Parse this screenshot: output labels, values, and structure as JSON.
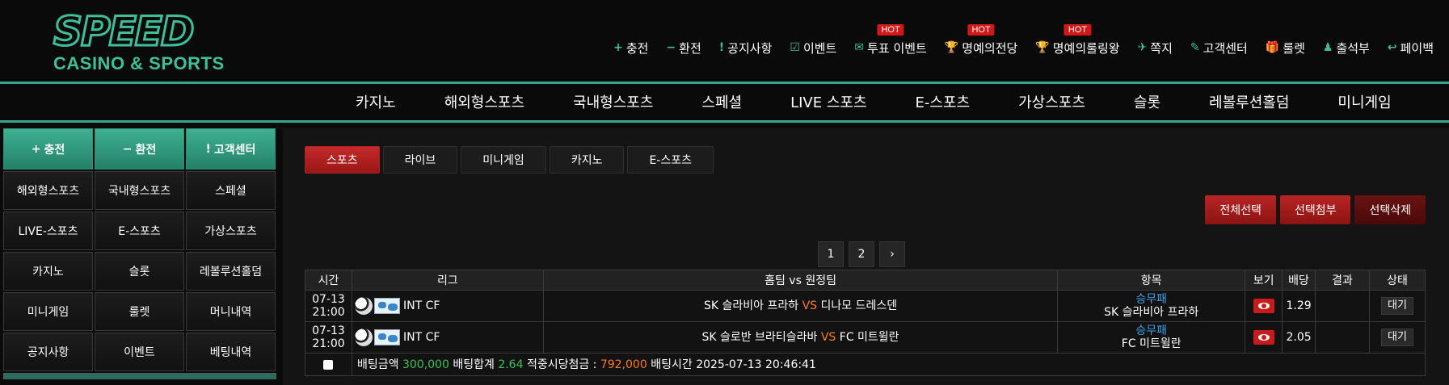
{
  "logo": {
    "word": "SPEED",
    "sub": "CASINO & SPORTS"
  },
  "topnav": [
    {
      "icon": "+",
      "label": "충전",
      "hot": ""
    },
    {
      "icon": "−",
      "label": "환전",
      "hot": ""
    },
    {
      "icon": "!",
      "label": "공지사항",
      "hot": ""
    },
    {
      "icon": "☑",
      "label": "이벤트",
      "hot": ""
    },
    {
      "icon": "✉",
      "label": "투표 이벤트",
      "hot": "HOT"
    },
    {
      "icon": "🏆",
      "label": "명예의전당",
      "hot": "HOT"
    },
    {
      "icon": "🏆",
      "label": "명예의룰링왕",
      "hot": "HOT"
    },
    {
      "icon": "✈",
      "label": "쪽지",
      "hot": ""
    },
    {
      "icon": "✎",
      "label": "고객센터",
      "hot": ""
    },
    {
      "icon": "🎁",
      "label": "룰렛",
      "hot": ""
    },
    {
      "icon": "♟",
      "label": "출석부",
      "hot": ""
    },
    {
      "icon": "↩",
      "label": "페이백",
      "hot": ""
    }
  ],
  "mainnav": [
    "카지노",
    "해외형스포츠",
    "국내형스포츠",
    "스페셜",
    "LIVE 스포츠",
    "E-스포츠",
    "가상스포츠",
    "슬롯",
    "레볼루션홀덤",
    "미니게임"
  ],
  "sidebar": {
    "top": [
      {
        "icon": "+",
        "label": "충전"
      },
      {
        "icon": "−",
        "label": "환전"
      },
      {
        "icon": "!",
        "label": "고객센터"
      }
    ],
    "rows": [
      [
        "해외형스포츠",
        "국내형스포츠",
        "스페셜"
      ],
      [
        "LIVE-스포츠",
        "E-스포츠",
        "가상스포츠"
      ],
      [
        "카지노",
        "슬롯",
        "레볼루션홀덤"
      ],
      [
        "미니게임",
        "룰렛",
        "머니내역"
      ],
      [
        "공지사항",
        "이벤트",
        "베팅내역"
      ]
    ]
  },
  "tabs": [
    "스포츠",
    "라이브",
    "미니게임",
    "카지노",
    "E-스포츠"
  ],
  "actions": [
    "전체선택",
    "선택첨부",
    "선택삭제"
  ],
  "pager": [
    "1",
    "2",
    "›"
  ],
  "table": {
    "headers": [
      "시간",
      "리그",
      "홈팀 vs 원정팀",
      "항목",
      "보기",
      "배당",
      "결과",
      "상태"
    ],
    "rows": [
      {
        "date": "07-13",
        "time": "21:00",
        "league": "INT CF",
        "home": "SK 슬라비아 프라하",
        "vs": "VS",
        "away": "디나모 드레스덴",
        "type": "승무패",
        "pick": "SK 슬라비아 프라하",
        "odds": "1.29",
        "result": "",
        "status": "대기"
      },
      {
        "date": "07-13",
        "time": "21:00",
        "league": "INT CF",
        "home": "SK 슬로반 브라티슬라바",
        "vs": "VS",
        "away": "FC 미트윌란",
        "type": "승무패",
        "pick": "FC 미트윌란",
        "odds": "2.05",
        "result": "",
        "status": "대기"
      }
    ],
    "summary": {
      "bet_label": "배팅금액",
      "bet_amount": "300,000",
      "total_label": "배팅합계",
      "total": "2.64",
      "win_label": "적중시당첨금 :",
      "win": "792,000",
      "time_label": "배팅시간",
      "time": "2025-07-13 20:46:41"
    }
  }
}
